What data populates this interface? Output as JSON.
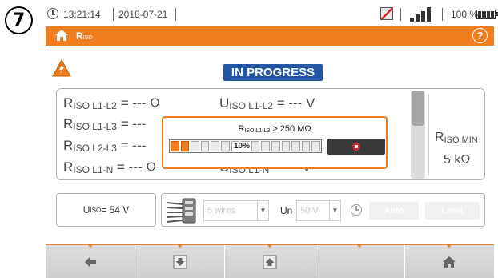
{
  "step_badge": "7",
  "statusbar": {
    "time": "13:21:14",
    "date": "2018-07-21",
    "battery_percent": "100 %",
    "battery_level": 1.0
  },
  "titlebar": {
    "title_main": "R",
    "title_sub": "ISO"
  },
  "status": "IN PROGRESS",
  "measurements": {
    "r_l1_l2": {
      "sym": "R",
      "sub": "ISO L1-L2",
      "rest": " = --- Ω"
    },
    "u_l1_l2": {
      "sym": "U",
      "sub": "ISO L1-L2",
      "rest": " = --- V"
    },
    "r_l1_l3": {
      "sym": "R",
      "sub": "ISO L1-L3",
      "rest": " = ---"
    },
    "r_l2_l3": {
      "sym": "R",
      "sub": "ISO L2-L3",
      "rest": " = ---"
    },
    "r_l1_n": {
      "sym": "R",
      "sub": "ISO L1-N",
      "rest": " = --- Ω"
    },
    "u_l1_n": {
      "sym": "U",
      "sub": "ISO L1-N",
      "rest": " = --- V"
    }
  },
  "riso_min": {
    "sym": "R",
    "sub": "ISO MIN",
    "value": "5 kΩ"
  },
  "progress": {
    "limit_sym": "R",
    "limit_sub": "ISO L1-L3",
    "limit_rest": " > 250 MΩ",
    "percent_text": "10%",
    "fraction": 0.1,
    "segments": 15
  },
  "uiso": {
    "sym": "U",
    "sub": "ISO",
    "rest": " = 54 V"
  },
  "settings": {
    "wires_value": "5 wires",
    "un_label": "Un",
    "un_value": "50 V",
    "auto_label": "Auto",
    "limit_label": "Limit"
  },
  "colors": {
    "accent": "#f07d1e",
    "status_badge": "#2456a8",
    "stop": "#d8262a"
  }
}
